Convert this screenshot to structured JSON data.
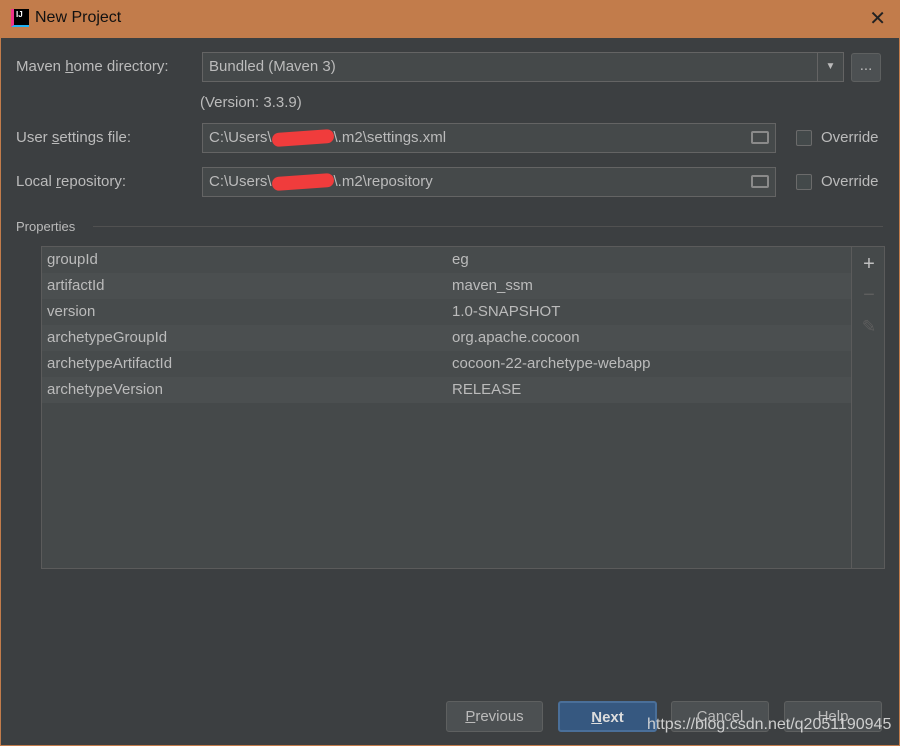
{
  "window": {
    "title": "New Project",
    "app_icon": "intellij-idea-icon",
    "close_icon": "close-icon"
  },
  "maven_home": {
    "label_pre": "Maven ",
    "label_u": "h",
    "label_post": "ome directory:",
    "value": "Bundled (Maven 3)",
    "version": "(Version: 3.3.9)",
    "browse_label": "..."
  },
  "settings_file": {
    "label_pre": "User ",
    "label_u": "s",
    "label_post": "ettings file:",
    "value_pre": "C:\\Users\\",
    "value_post": "\\.m2\\settings.xml",
    "override": "Override",
    "override_checked": false
  },
  "local_repo": {
    "label_pre": "Local ",
    "label_u": "r",
    "label_post": "epository:",
    "value_pre": "C:\\Users\\",
    "value_post": "\\.m2\\repository",
    "override": "Override",
    "override_checked": false
  },
  "properties": {
    "title": "Properties",
    "rows": [
      {
        "key": "groupId",
        "value": "eg"
      },
      {
        "key": "artifactId",
        "value": "maven_ssm"
      },
      {
        "key": "version",
        "value": "1.0-SNAPSHOT"
      },
      {
        "key": "archetypeGroupId",
        "value": "org.apache.cocoon"
      },
      {
        "key": "archetypeArtifactId",
        "value": "cocoon-22-archetype-webapp"
      },
      {
        "key": "archetypeVersion",
        "value": "RELEASE"
      }
    ],
    "add": "+",
    "remove": "−",
    "edit": "✎"
  },
  "buttons": {
    "previous_u": "P",
    "previous_rest": "revious",
    "next_u": "N",
    "next_rest": "ext",
    "cancel": "Cancel",
    "help": "Help"
  },
  "watermark": "https://blog.csdn.net/q2051190945"
}
